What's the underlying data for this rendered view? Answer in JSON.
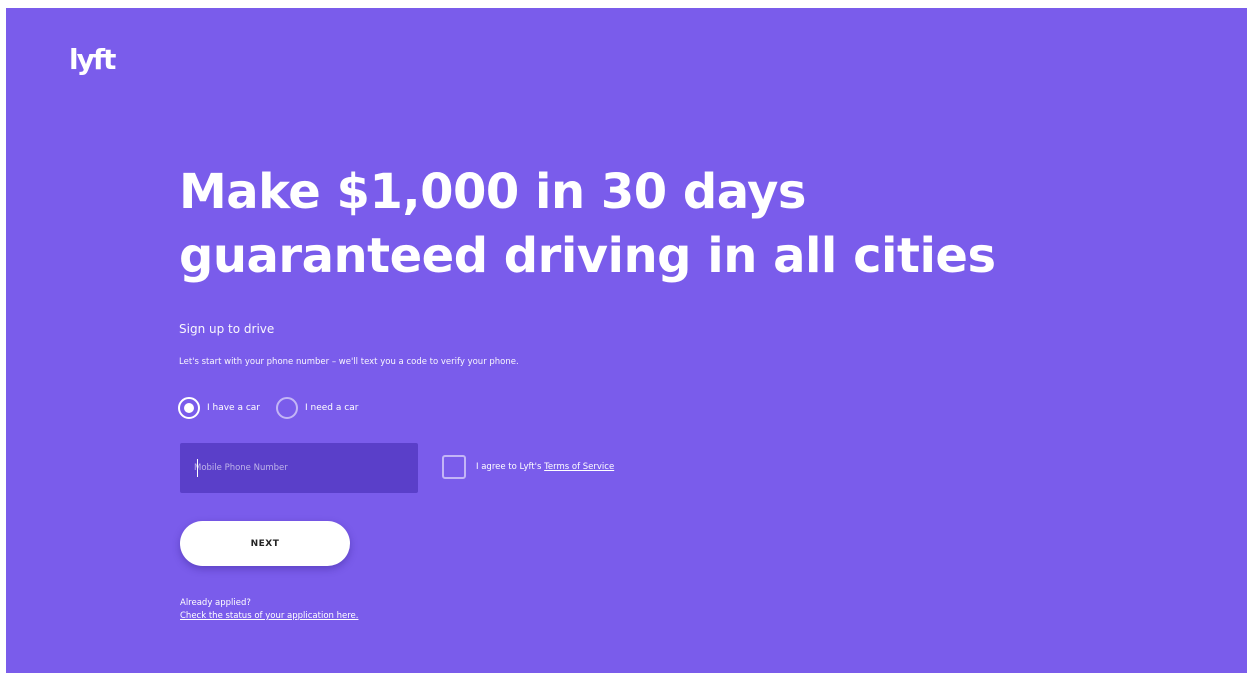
{
  "brand": {
    "logo_text": "lyft",
    "background_color": "#7a5ceb",
    "field_color": "#5a3fc9"
  },
  "hero": {
    "headline_line1": "Make $1,000 in 30 days",
    "headline_line2": "guaranteed driving in all cities"
  },
  "form": {
    "subtitle": "Sign up to drive",
    "description": "Let's start with your phone number – we'll text you a code to verify your phone.",
    "radio_options": [
      {
        "label": "I have a car",
        "checked": true
      },
      {
        "label": "I need a car",
        "checked": false
      }
    ],
    "phone_placeholder": "Mobile Phone Number",
    "phone_value": "",
    "agree_text": "I agree to Lyft's ",
    "terms_link": "Terms of Service",
    "agree_checked": false,
    "next_label": "NEXT"
  },
  "footer": {
    "already_applied": "Already applied?",
    "status_link": "Check the status of your application here."
  }
}
